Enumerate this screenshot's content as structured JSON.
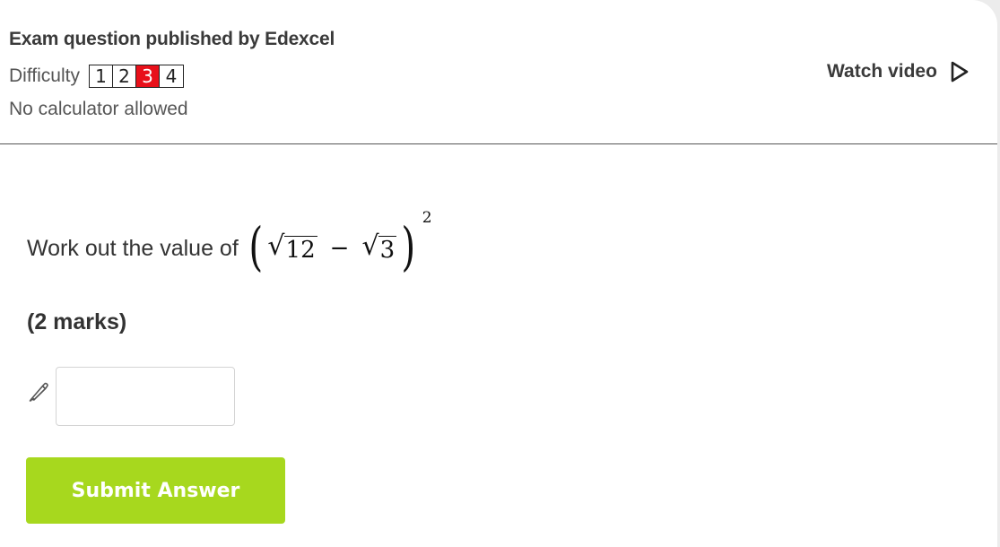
{
  "header": {
    "exam_title": "Exam question published by Edexcel",
    "difficulty_label": "Difficulty",
    "difficulty_levels": [
      "1",
      "2",
      "3",
      "4"
    ],
    "difficulty_selected": "3",
    "calculator_note": "No calculator allowed",
    "watch_video_label": "Watch video"
  },
  "question": {
    "prompt": "Work out the value of",
    "expression": {
      "open_paren": "(",
      "close_paren": ")",
      "radical_sign": "√",
      "term1": "12",
      "operator": "−",
      "term2": "3",
      "exponent": "2"
    },
    "marks": "(2 marks)"
  },
  "answer": {
    "value": "",
    "placeholder": ""
  },
  "submit": {
    "label": "Submit Answer"
  },
  "colors": {
    "selected_difficulty": "#e8101a",
    "submit_button": "#a7d81e",
    "text": "#333333"
  },
  "icons": {
    "play": "play-icon",
    "pencil": "pencil-icon"
  }
}
